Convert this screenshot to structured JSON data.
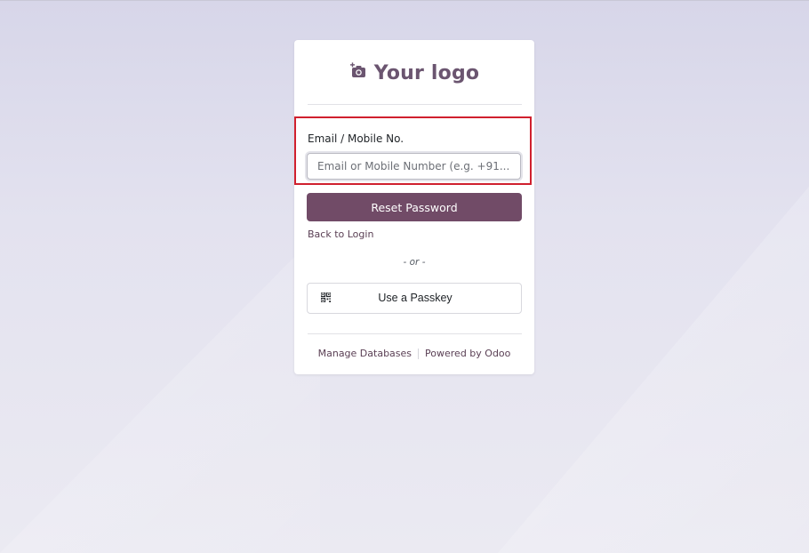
{
  "logo": {
    "text": "Your logo",
    "icon": "camera-plus-icon",
    "color": "#6b5570"
  },
  "form": {
    "email_label": "Email / Mobile No.",
    "email_placeholder": "Email or Mobile Number (e.g. +91...)",
    "email_value": "",
    "reset_button": "Reset Password",
    "back_link": "Back to Login",
    "or_text": "- or -",
    "passkey_button": "Use a Passkey",
    "passkey_icon": "qr-code-icon"
  },
  "footer": {
    "manage_databases": "Manage Databases",
    "powered_by": "Powered by Odoo"
  },
  "colors": {
    "brand": "#714b67",
    "highlight": "#d0202e"
  }
}
